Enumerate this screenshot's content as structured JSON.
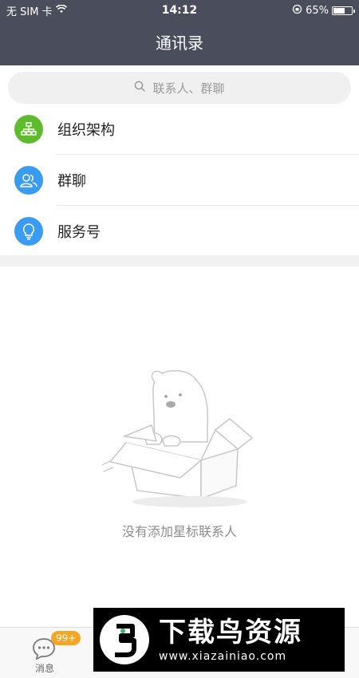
{
  "status_bar": {
    "carrier": "无 SIM 卡",
    "time": "14:12",
    "battery": "65%",
    "battery_level": 0.65
  },
  "header": {
    "title": "通讯录"
  },
  "search": {
    "placeholder": "联系人、群聊"
  },
  "menu": [
    {
      "label": "组织架构",
      "icon": "org-chart-icon",
      "color": "#5ebc2c"
    },
    {
      "label": "群聊",
      "icon": "group-chat-icon",
      "color": "#3a9cf0"
    },
    {
      "label": "服务号",
      "icon": "bulb-icon",
      "color": "#3a9cf0"
    }
  ],
  "empty_state": {
    "text": "没有添加星标联系人"
  },
  "tabbar": {
    "messages": {
      "label": "消息",
      "badge": "99+"
    }
  },
  "watermark": {
    "title": "下载鸟资源",
    "url": "www.xiazainiao.com"
  },
  "colors": {
    "header_bg": "#4a4d5c",
    "badge": "#f5a623"
  }
}
